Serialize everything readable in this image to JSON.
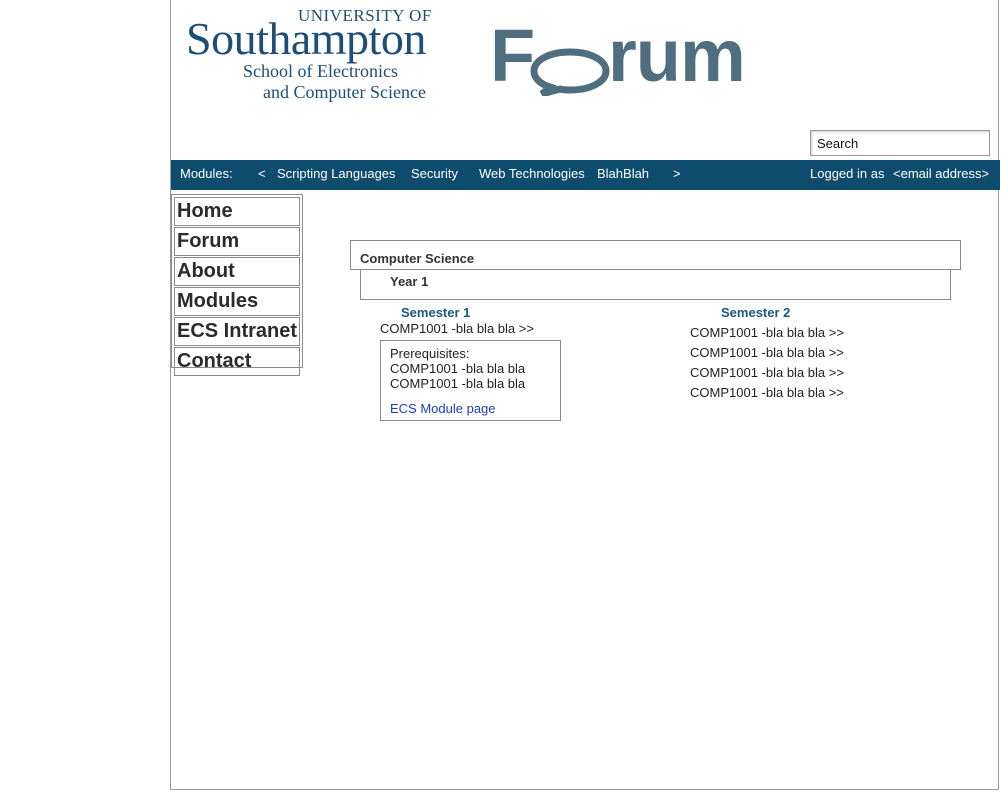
{
  "logo": {
    "university_top": "UNIVERSITY OF",
    "university_main": "Southampton",
    "school_line1": "School of Electronics",
    "school_line2": "and Computer Science",
    "forum_F": "F",
    "forum_rest": "rum"
  },
  "search": {
    "placeholder": "Search"
  },
  "navbar": {
    "modules_label": "Modules:",
    "prev": "<",
    "items": [
      "Scripting Languages",
      "Security",
      "Web Technologies",
      "BlahBlah"
    ],
    "next": ">",
    "logged_in_label": "Logged in as",
    "user_email": "<email address>"
  },
  "sidebar": {
    "items": [
      {
        "label": "Home"
      },
      {
        "label": "Forum"
      },
      {
        "label": "About"
      },
      {
        "label": "Modules"
      },
      {
        "label": "ECS Intranet"
      },
      {
        "label": "Contact"
      }
    ]
  },
  "content": {
    "department": "Computer Science",
    "year": "Year 1",
    "semester1": {
      "title": "Semester 1",
      "modules": [
        "COMP1001 -bla bla bla  >>"
      ],
      "prerequisites": {
        "label": "Prerequisites:",
        "items": [
          "COMP1001 -bla bla bla",
          "COMP1001 -bla bla bla"
        ],
        "link": "ECS Module page"
      }
    },
    "semester2": {
      "title": "Semester 2",
      "modules": [
        "COMP1001 -bla bla bla  >>",
        "COMP1001 -bla bla bla  >>",
        "COMP1001 -bla bla bla  >>",
        "COMP1001 -bla bla bla  >>"
      ]
    }
  },
  "colors": {
    "navbar_bg": "#0e4c6e",
    "logo_blue": "#1c4e78",
    "forum_gray": "#4f6f80",
    "semester_title": "#1a5a7e",
    "link": "#1a3fc0"
  }
}
